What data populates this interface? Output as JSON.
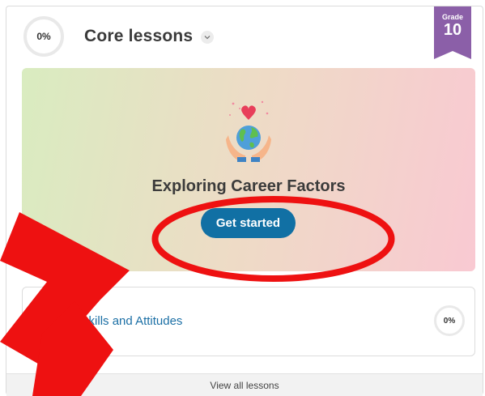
{
  "header": {
    "progress": "0%",
    "title": "Core lessons"
  },
  "grade_badge": {
    "label": "Grade",
    "number": "10",
    "color": "#8b5fa8"
  },
  "current_lesson": {
    "title": "Exploring Career Factors",
    "button_label": "Get started",
    "button_color": "#1170a4"
  },
  "next_lesson": {
    "label": "kplace Skills and Attitudes",
    "progress": "0%"
  },
  "footer": {
    "view_all_label": "View all lessons"
  },
  "annotations": {
    "color": "#ee1111"
  },
  "icons": {
    "title_chevron": "chevron-down-icon",
    "illustration": "globe-in-hands-icon"
  }
}
